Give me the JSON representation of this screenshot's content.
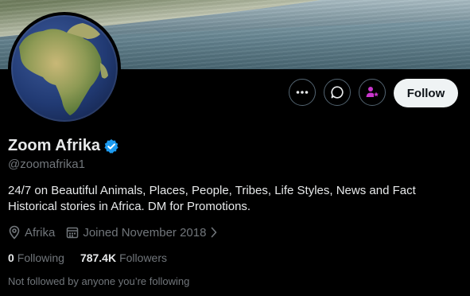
{
  "profile": {
    "display_name": "Zoom Afrika",
    "handle": "@zoomafrika1",
    "bio": "24/7 on Beautiful Animals, Places, People, Tribes, Life Styles, News and Fact Historical stories in Africa. DM for Promotions.",
    "location": "Afrika",
    "joined": "Joined November 2018",
    "verified_icon": "verified-badge-icon"
  },
  "actions": {
    "more_icon": "more-icon",
    "message_icon": "message-icon",
    "subscribe_icon": "subscribe-icon",
    "follow_label": "Follow"
  },
  "stats": {
    "following_count": "0",
    "following_label": "Following",
    "followers_count": "787.4K",
    "followers_label": "Followers"
  },
  "footnote": "Not followed by anyone you’re following",
  "colors": {
    "background": "#000000",
    "primary_text": "#e7e9ea",
    "secondary_text": "#71767b",
    "verified": "#1d9bf0",
    "subscribe_accent": "#c936cc",
    "follow_bg": "#eff3f4"
  }
}
